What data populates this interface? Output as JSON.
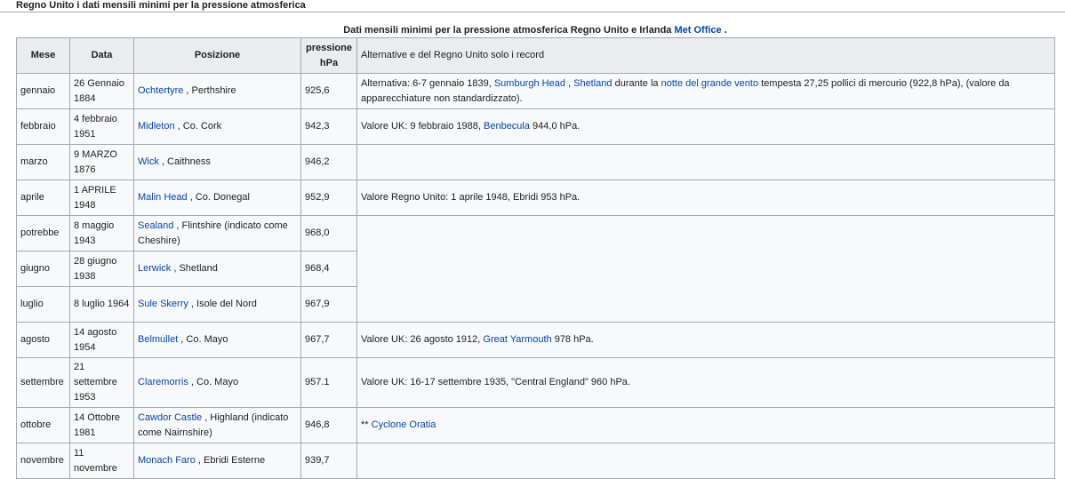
{
  "heading": "Regno Unito i dati mensili minimi per la pressione atmosferica",
  "caption": {
    "text": "Dati mensili minimi per la pressione atmosferica Regno Unito e Irlanda",
    "link": "Met Office",
    "suffix": " ."
  },
  "headers": {
    "mese": "Mese",
    "data": "Data",
    "posizione": "Posizione",
    "pressione": "pressione hPa",
    "note": "Alternative e del Regno Unito solo i record"
  },
  "rows": [
    {
      "mese": "gennaio",
      "data": "26 Gennaio 1884",
      "place_link": "Ochtertyre",
      "place_rest": " , Perthshire",
      "pressione": "925,6",
      "note": [
        {
          "t": "Alternativa: 6-7 gennaio 1839, "
        },
        {
          "t": "Sumburgh Head",
          "link": true
        },
        {
          "t": " , "
        },
        {
          "t": "Shetland",
          "link": true
        },
        {
          "t": " durante la "
        },
        {
          "t": "notte del grande vento",
          "link": true
        },
        {
          "t": " tempesta 27,25 pollici di mercurio (922,8 hPa), (valore da apparecchiature non standardizzato)."
        }
      ]
    },
    {
      "mese": "febbraio",
      "data": "4 febbraio 1951",
      "place_link": "Midleton",
      "place_rest": " , Co. Cork",
      "pressione": "942,3",
      "note": [
        {
          "t": "Valore UK: 9 febbraio 1988, "
        },
        {
          "t": "Benbecula",
          "link": true
        },
        {
          "t": " 944,0 hPa."
        }
      ]
    },
    {
      "mese": "marzo",
      "data": "9 MARZO 1876",
      "place_link": "Wick",
      "place_rest": " , Caithness",
      "pressione": "946,2",
      "note": []
    },
    {
      "mese": "aprile",
      "data": "1 APRILE 1948",
      "place_link": "Malin Head",
      "place_rest": " , Co. Donegal",
      "pressione": "952,9",
      "note": [
        {
          "t": "Valore Regno Unito: 1 aprile 1948, Ebridi 953 hPa."
        }
      ]
    },
    {
      "mese": "potrebbe",
      "data": "8 maggio 1943",
      "place_link": "Sealand",
      "place_rest": " , Flintshire (indicato come Cheshire)",
      "pressione": "968,0",
      "note": null,
      "notespan": 3
    },
    {
      "mese": "giugno",
      "data": "28 giugno 1938",
      "place_link": "Lerwick",
      "place_rest": " , Shetland",
      "pressione": "968,4"
    },
    {
      "mese": "luglio",
      "data": "8 luglio 1964",
      "place_link": "Sule Skerry",
      "place_rest": " , Isole del Nord",
      "pressione": "967,9"
    },
    {
      "mese": "agosto",
      "data": "14 agosto 1954",
      "place_link": "Belmullet",
      "place_rest": " , Co. Mayo",
      "pressione": "967,7",
      "note": [
        {
          "t": "Valore UK: 26 agosto 1912, "
        },
        {
          "t": "Great Yarmouth",
          "link": true
        },
        {
          "t": " 978 hPa."
        }
      ]
    },
    {
      "mese": "settembre",
      "data": "21 settembre 1953",
      "place_link": "Claremorris",
      "place_rest": " , Co. Mayo",
      "pressione": "957.1",
      "note": [
        {
          "t": "Valore UK: 16-17 settembre 1935, \"Central England\" 960 hPa."
        }
      ]
    },
    {
      "mese": "ottobre",
      "data": "14 Ottobre 1981",
      "place_link": "Cawdor Castle",
      "place_rest": " , Highland (indicato come Nairnshire)",
      "pressione": "946,8",
      "note": [
        {
          "t": "** "
        },
        {
          "t": "Cyclone Oratia",
          "link": true
        }
      ]
    },
    {
      "mese": "novembre",
      "data": "11 novembre",
      "place_link": "Monach Faro",
      "place_rest": " , Ebridi Esterne",
      "pressione": "939,7",
      "note": []
    }
  ],
  "colors": {
    "link": "#0645ad",
    "border": "#a2a9b1",
    "header_bg": "#eaecf0",
    "cell_bg": "#f8f9fa"
  }
}
